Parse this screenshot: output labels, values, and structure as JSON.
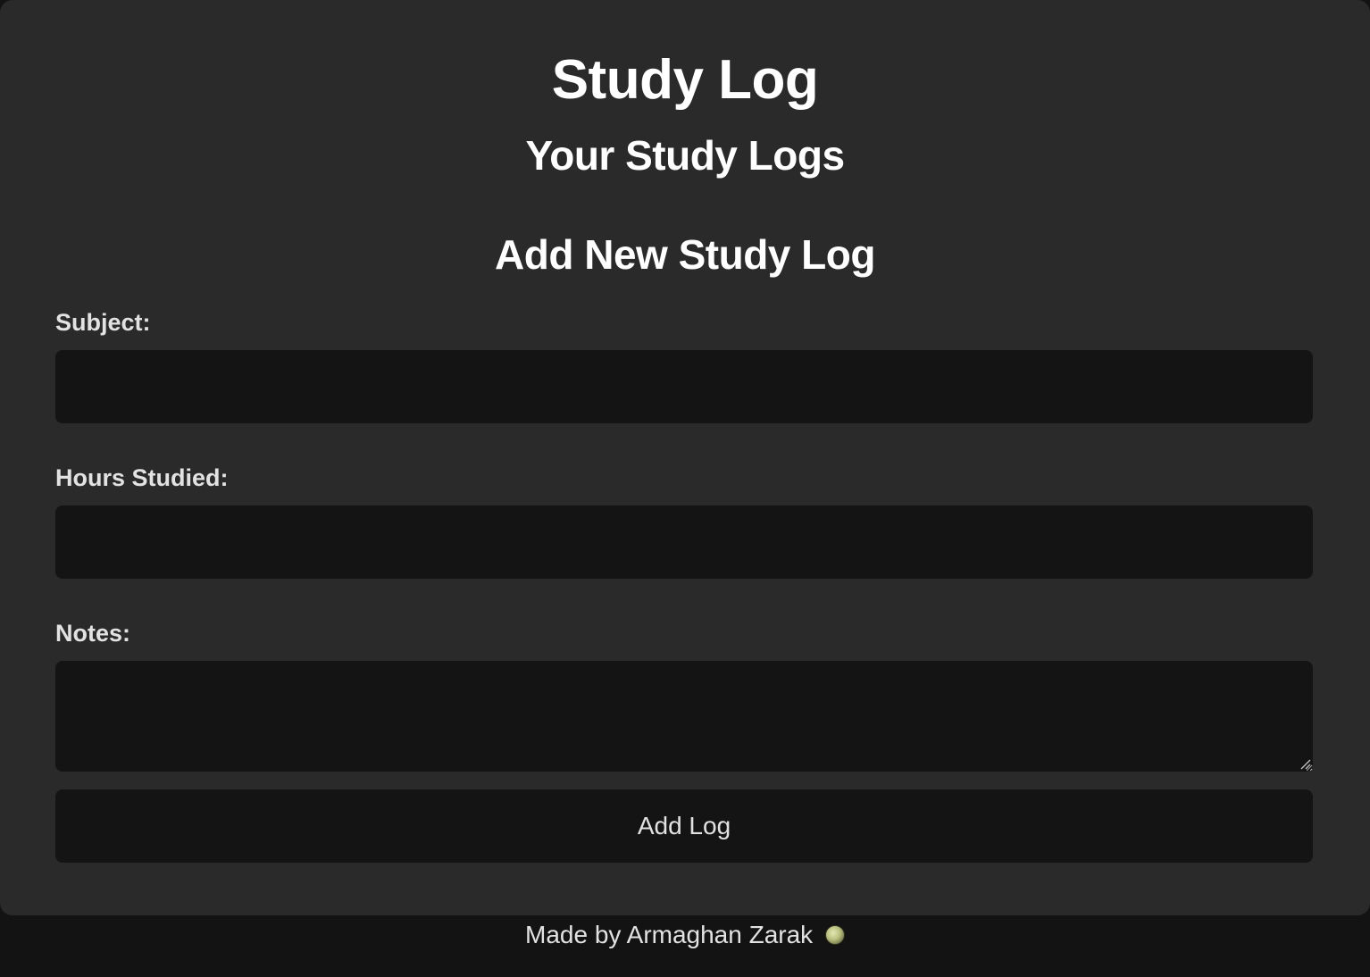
{
  "app": {
    "title": "Study Log",
    "logs_heading": "Your Study Logs",
    "form_heading": "Add New Study Log"
  },
  "form": {
    "subject_label": "Subject:",
    "subject_value": "",
    "hours_label": "Hours Studied:",
    "hours_value": "",
    "notes_label": "Notes:",
    "notes_value": "",
    "submit_label": "Add Log"
  },
  "footer": {
    "text": "Made by Armaghan Zarak",
    "icon": "green-orb-icon"
  },
  "colors": {
    "page_background": "#131313",
    "card_background": "#2a2a2a",
    "field_background": "#141414",
    "text_primary": "#ffffff",
    "text_secondary": "#e2e2e2"
  }
}
